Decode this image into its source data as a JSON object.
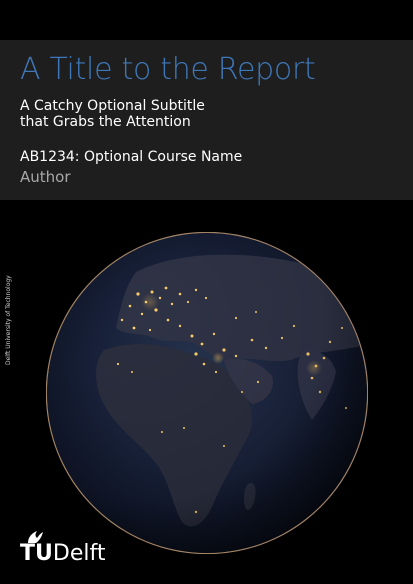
{
  "cover": {
    "title": "A Title to the Report",
    "subtitle_line1": "A Catchy Optional Subtitle",
    "subtitle_line2": "that Grabs the Attention",
    "course": "AB1234: Optional Course Name",
    "author": "Author",
    "institution_vertical": "Delft University of Technology"
  },
  "logo": {
    "tu": "TU",
    "delft": "Delft",
    "icon": "tu-delft-flame-icon"
  },
  "image": {
    "subject": "earth-at-night-image"
  },
  "colors": {
    "background": "#000000",
    "band": "#1e1e1e",
    "title": "#3e78b8",
    "subtitle": "#ffffff",
    "author": "#a8a8a8"
  }
}
